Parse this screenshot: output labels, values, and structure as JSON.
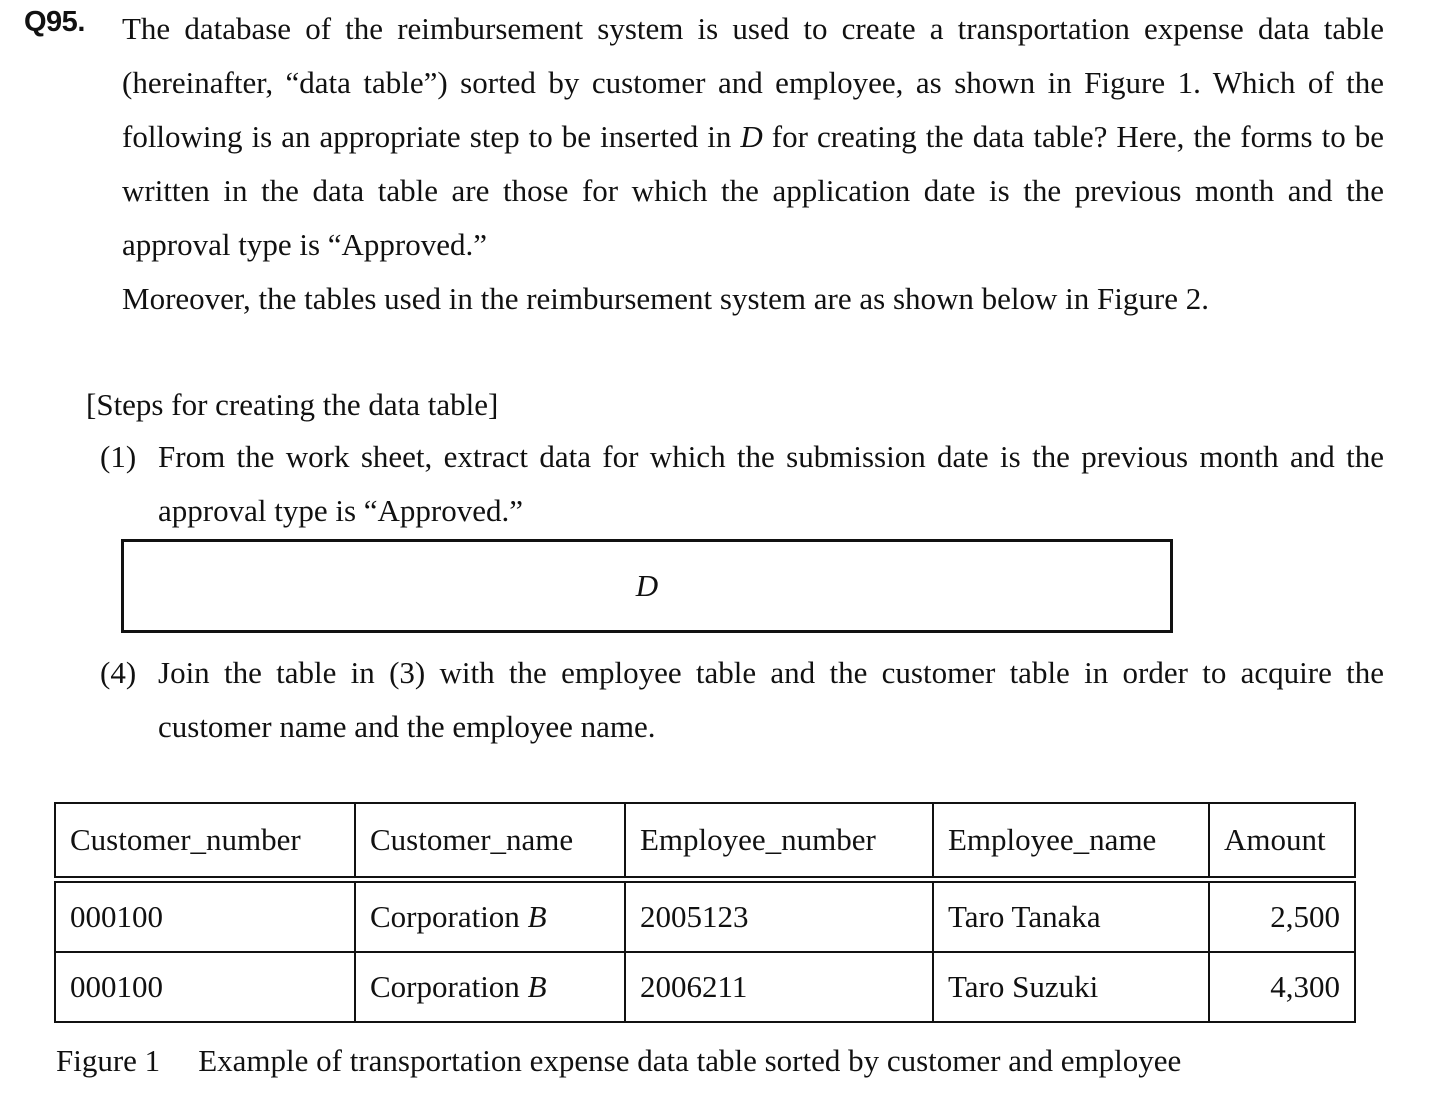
{
  "question": {
    "number": "Q95.",
    "paragraph1_part1": "The database of the reimbursement system is used to create a transportation expense data table (hereinafter, “data table”) sorted by customer and employee, as shown in Figure 1. Which of the following is an appropriate step to be inserted in ",
    "paragraph1_var": "D",
    "paragraph1_part2": " for creating the data table? Here, the forms to be written in the data table are those for which the application date is the previous month and the approval type is “Approved.”",
    "paragraph2": "Moreover, the tables used in the reimbursement system are as shown below in Figure 2."
  },
  "steps": {
    "heading": "[Steps for creating the data table]",
    "step1_label": "(1)",
    "step1_text": "From the work sheet, extract data for which the submission date is the previous month and the approval type is “Approved.”",
    "blank_label": "D",
    "step4_label": "(4)",
    "step4_text": "Join the table in (3) with the employee table and the customer table in order to acquire the customer name and the employee name."
  },
  "figure1": {
    "headers": [
      "Customer_number",
      "Customer_name",
      "Employee_number",
      "Employee_name",
      "Amount"
    ],
    "rows": [
      {
        "customer_number": "000100",
        "customer_name_prefix": "Corporation ",
        "customer_name_var": "B",
        "employee_number": "2005123",
        "employee_name": "Taro Tanaka",
        "amount": "2,500"
      },
      {
        "customer_number": "000100",
        "customer_name_prefix": "Corporation ",
        "customer_name_var": "B",
        "employee_number": "2006211",
        "employee_name": "Taro Suzuki",
        "amount": "4,300"
      }
    ],
    "caption_label": "Figure 1",
    "caption_text": "Example of transportation expense data table sorted by customer and employee"
  }
}
